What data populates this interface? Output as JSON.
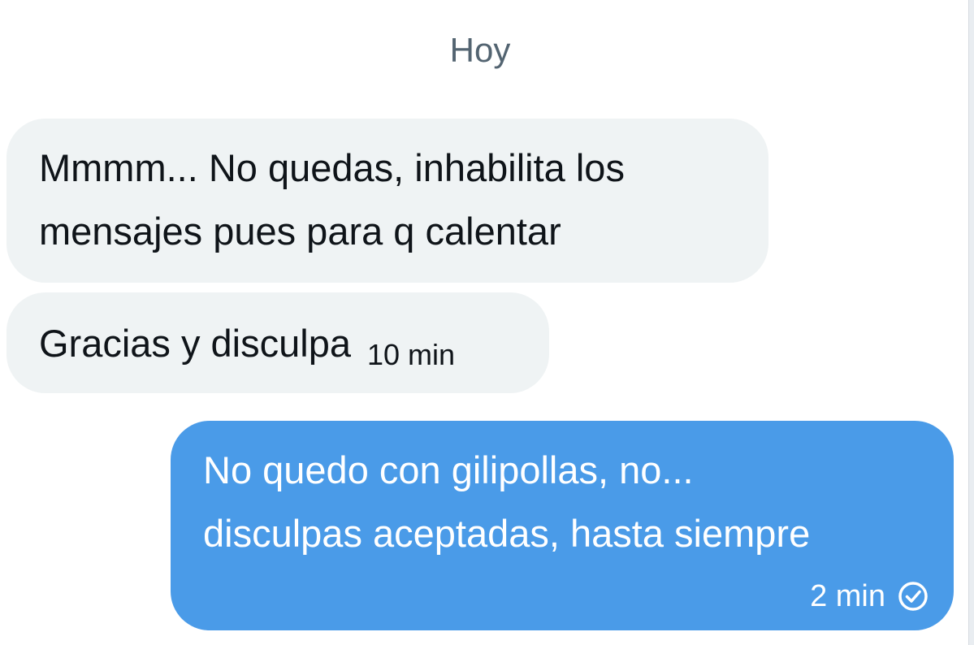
{
  "date_separator": "Hoy",
  "messages": [
    {
      "direction": "incoming",
      "lines": [
        "Mmmm... No quedas, inhabilita los",
        "mensajes pues para q calentar"
      ]
    },
    {
      "direction": "incoming",
      "text": "Gracias y disculpa",
      "time": "10 min"
    },
    {
      "direction": "outgoing",
      "lines": [
        "No quedo con gilipollas, no...",
        "disculpas aceptadas, hasta siempre"
      ],
      "time": "2 min",
      "status_icon": "check-circle-icon"
    }
  ],
  "colors": {
    "incoming_bg": "#eff3f4",
    "outgoing_bg": "#4a9be8",
    "text_dark": "#0f1419",
    "separator_text": "#536471"
  }
}
